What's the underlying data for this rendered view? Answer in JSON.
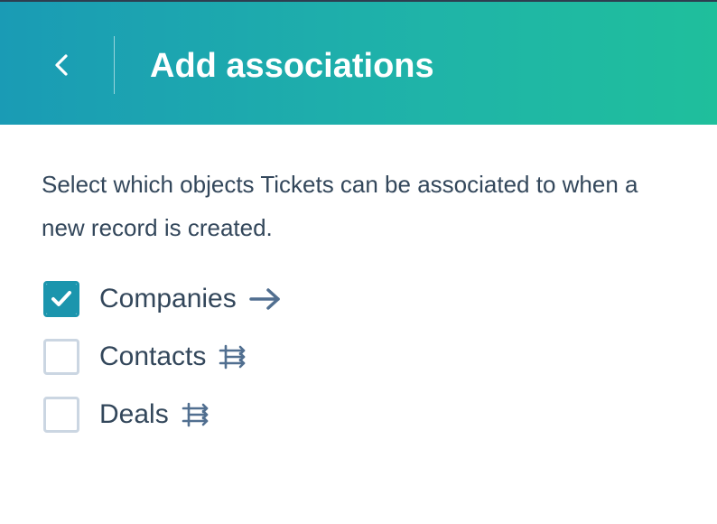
{
  "header": {
    "title": "Add associations",
    "back_icon": "chevron-left-icon"
  },
  "description": "Select which objects Tickets can be associated to when a new record is created.",
  "options": [
    {
      "label": "Companies",
      "checked": true,
      "icon": "arrow-right-icon"
    },
    {
      "label": "Contacts",
      "checked": false,
      "icon": "association-icon"
    },
    {
      "label": "Deals",
      "checked": false,
      "icon": "association-icon"
    }
  ],
  "colors": {
    "header_gradient_start": "#1a9bb5",
    "header_gradient_end": "#1fbf9c",
    "text": "#33475b",
    "checkbox_checked": "#1b95ad",
    "checkbox_unchecked_border": "#cbd6e2",
    "icon": "#516f90"
  }
}
